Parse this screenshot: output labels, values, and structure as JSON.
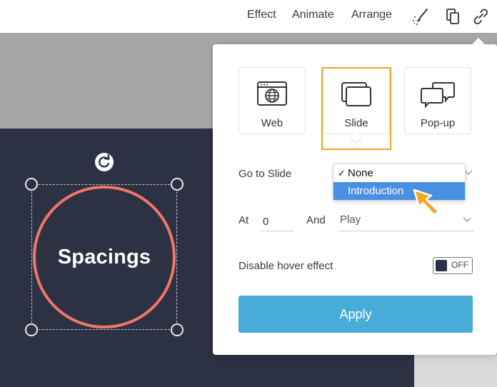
{
  "toolbar": {
    "effect_label": "Effect",
    "animate_label": "Animate",
    "arrange_label": "Arrange",
    "icons": [
      "brush-sparkle-icon",
      "copy-icon",
      "link-icon"
    ]
  },
  "canvas": {
    "shape_text": "Spacings",
    "shape_border_color": "#f2766a",
    "slide_bg_color": "#2c3143"
  },
  "link_panel": {
    "types": [
      {
        "label": "Web",
        "icon": "browser-globe-icon"
      },
      {
        "label": "Slide",
        "icon": "slides-icon",
        "selected": true
      },
      {
        "label": "Pop-up",
        "icon": "speech-bubbles-icon"
      }
    ],
    "goto_label": "Go to Slide",
    "goto_options": [
      "None",
      "Introduction"
    ],
    "goto_checked": "None",
    "goto_highlighted": "Introduction",
    "at_label": "At",
    "at_value": "0",
    "and_label": "And",
    "play_value": "Play",
    "hover_label": "Disable hover effect",
    "toggle_text": "OFF",
    "apply_label": "Apply",
    "highlight_color": "#f5a623",
    "apply_color": "#47acd8"
  }
}
